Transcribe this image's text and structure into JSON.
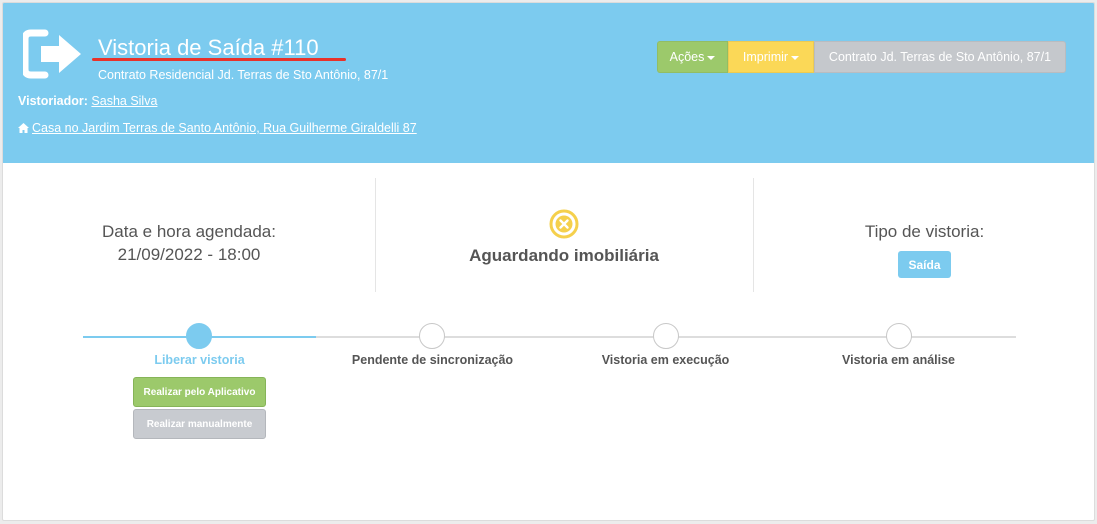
{
  "header": {
    "title": "Vistoria de Saída #110",
    "subtitle": "Contrato Residencial Jd. Terras de Sto Antônio, 87/1",
    "inspector_label": "Vistoriador:",
    "inspector_name": "Sasha Silva",
    "address": "Casa no Jardim Terras de Santo Antônio, Rua Guilherme Giraldelli 87",
    "icon": "exit-icon",
    "address_icon": "home-icon"
  },
  "toolbar": {
    "actions_label": "Ações",
    "print_label": "Imprimir",
    "contract_label": "Contrato Jd. Terras de Sto Antônio, 87/1"
  },
  "info": {
    "schedule_label": "Data e hora agendada:",
    "schedule_value": "21/09/2022 - 18:00",
    "status_icon": "x-circle-icon",
    "status_text": "Aguardando imobiliária",
    "type_label": "Tipo de vistoria:",
    "type_value": "Saída"
  },
  "steps": [
    {
      "label": "Liberar vistoria",
      "active": true
    },
    {
      "label": "Pendente de sincronização",
      "active": false
    },
    {
      "label": "Vistoria em execução",
      "active": false
    },
    {
      "label": "Vistoria em análise",
      "active": false
    }
  ],
  "step_actions": {
    "app_label": "Realizar pelo Aplicativo",
    "manual_label": "Realizar manualmente"
  },
  "colors": {
    "header_bg": "#7ccbef",
    "actions_btn": "#9cc96b",
    "print_btn": "#fbd857",
    "contract_btn": "#c5c8cc",
    "title_underline": "#e8322a",
    "status_icon": "#f5d04c"
  }
}
